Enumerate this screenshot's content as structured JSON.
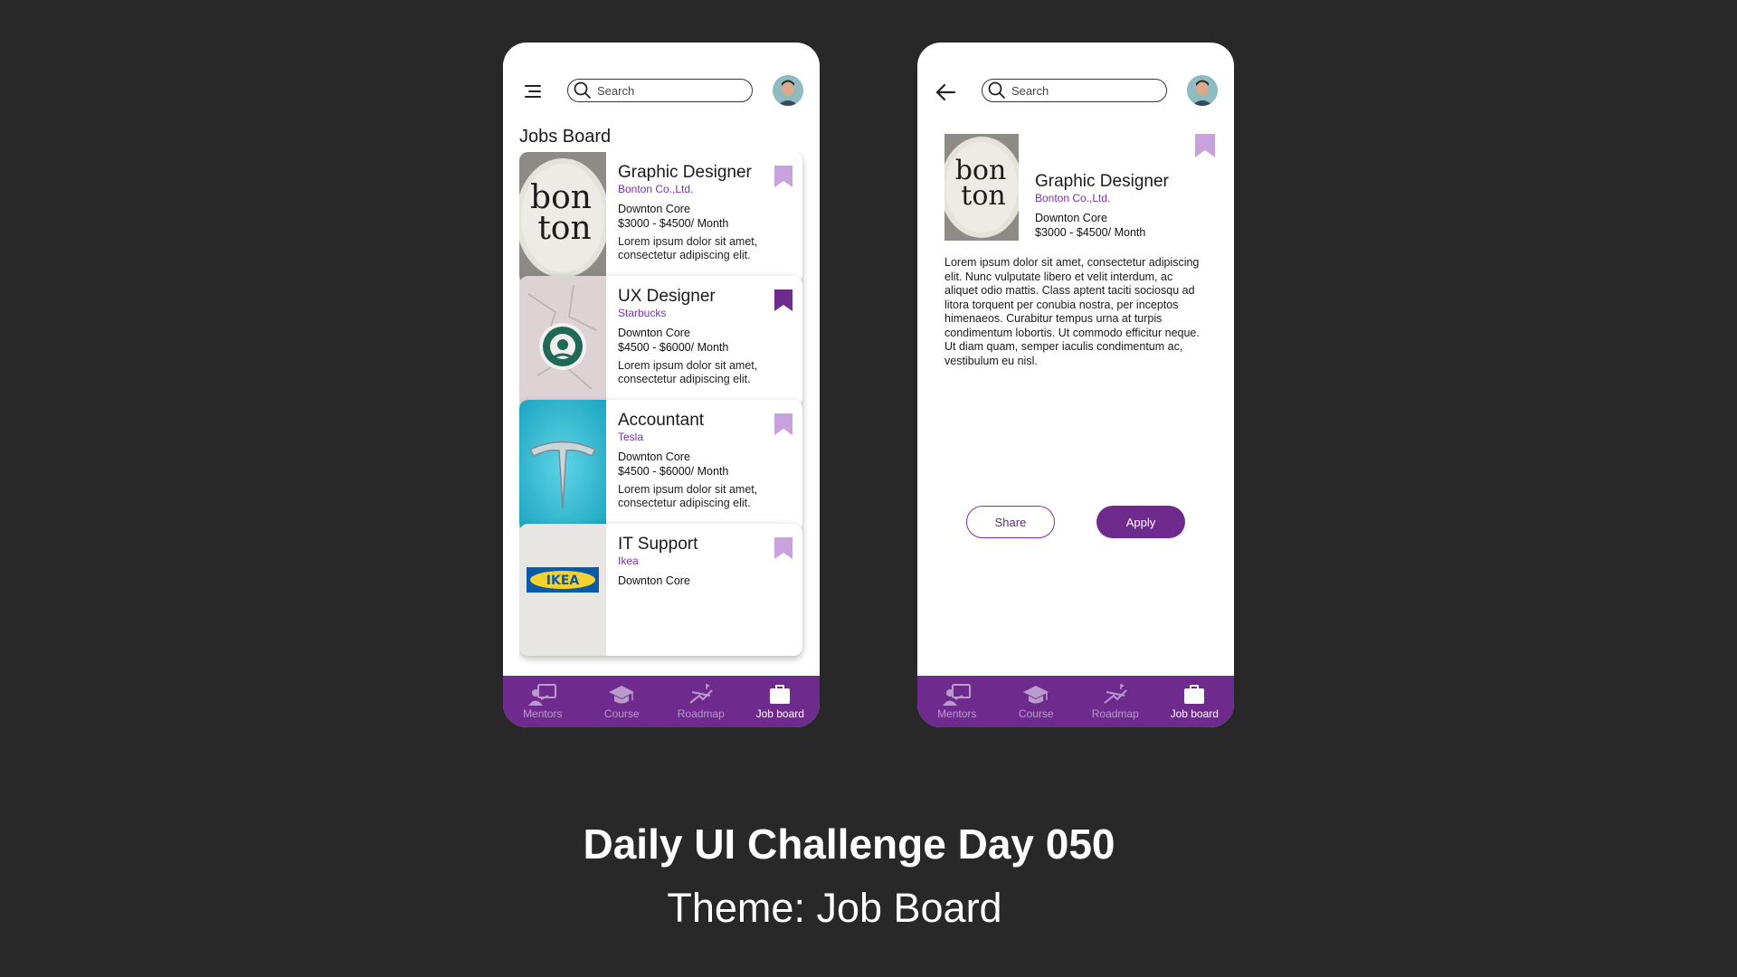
{
  "colors": {
    "accent": "#6f2a8e",
    "accent_text": "#7b2fb0",
    "bookmark_light": "#c8a2dc",
    "bookmark_dark": "#6f2a8e",
    "background": "#282828"
  },
  "search": {
    "placeholder": "Search"
  },
  "list_screen": {
    "title": "Jobs Board",
    "jobs": [
      {
        "title": "Graphic Designer",
        "company": "Bonton Co.,Ltd.",
        "location": "Downton Core",
        "salary": "$3000 - $4500/ Month",
        "description": "Lorem ipsum dolor sit amet, consectetur adipiscing elit.",
        "bookmarked": false,
        "logo_text": [
          "bon",
          "ton"
        ]
      },
      {
        "title": "UX Designer",
        "company": "Starbucks",
        "location": "Downton Core",
        "salary": "$4500 - $6000/ Month",
        "description": "Lorem ipsum dolor sit amet, consectetur adipiscing elit.",
        "bookmarked": true
      },
      {
        "title": "Accountant",
        "company": "Tesla",
        "location": "Downton Core",
        "salary": "$4500 - $6000/ Month",
        "description": "Lorem ipsum dolor sit amet, consectetur adipiscing elit.",
        "bookmarked": false
      },
      {
        "title": "IT Support",
        "company": "Ikea",
        "location": "Downton Core",
        "salary": "",
        "description": "",
        "bookmarked": false,
        "logo_text": "IKEA"
      }
    ]
  },
  "detail_screen": {
    "title": "Graphic Designer",
    "company": "Bonton Co.,Ltd.",
    "location": "Downton Core",
    "salary": "$3000 - $4500/ Month",
    "description": "Lorem ipsum dolor sit amet, consectetur adipiscing elit. Nunc vulputate libero et velit interdum, ac aliquet odio mattis. Class aptent taciti sociosqu ad litora torquent per conubia nostra, per inceptos himenaeos. Curabitur tempus urna at turpis condimentum lobortis. Ut commodo efficitur neque. Ut diam quam, semper iaculis condimentum ac, vestibulum eu nisl.",
    "share_label": "Share",
    "apply_label": "Apply",
    "bookmarked": false
  },
  "nav": [
    {
      "label": "Mentors",
      "icon": "mentor-icon",
      "active": false
    },
    {
      "label": "Course",
      "icon": "graduation-cap-icon",
      "active": false
    },
    {
      "label": "Roadmap",
      "icon": "roadmap-icon",
      "active": false
    },
    {
      "label": "Job board",
      "icon": "briefcase-icon",
      "active": true
    }
  ],
  "caption": {
    "headline": "Daily UI Challenge Day 050",
    "subline": "Theme: Job Board"
  }
}
